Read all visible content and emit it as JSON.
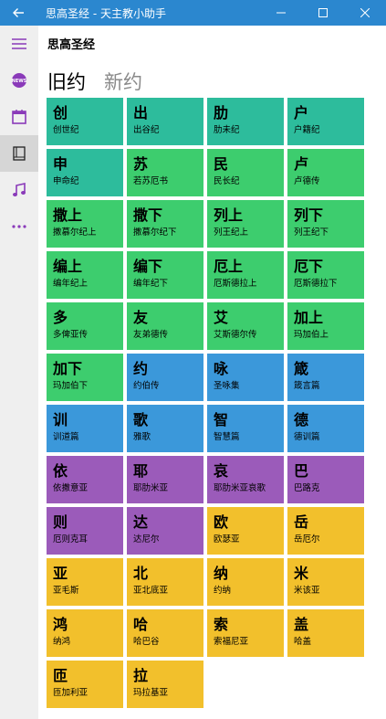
{
  "window": {
    "title": "思高圣经 - 天主教小助手"
  },
  "page": {
    "title": "思高圣经"
  },
  "tabs": [
    {
      "label": "旧约",
      "active": true
    },
    {
      "label": "新约",
      "active": false
    }
  ],
  "colors": {
    "titlebar": "#2b87cf",
    "teal": "#2dbc9c",
    "green": "#3dcd6e",
    "blue": "#3b98da",
    "purple": "#9b5bba",
    "yellow": "#f2c02c",
    "accent_icon": "#8a3ab9"
  },
  "sidebar": {
    "items": [
      {
        "icon": "hamburger-menu-icon"
      },
      {
        "icon": "news-icon"
      },
      {
        "icon": "calendar-icon"
      },
      {
        "icon": "book-icon",
        "active": true
      },
      {
        "icon": "music-note-icon"
      },
      {
        "icon": "more-dots-icon"
      }
    ]
  },
  "books": [
    {
      "abbr": "创",
      "name": "创世纪",
      "color": "teal"
    },
    {
      "abbr": "出",
      "name": "出谷纪",
      "color": "teal"
    },
    {
      "abbr": "肋",
      "name": "肋未纪",
      "color": "teal"
    },
    {
      "abbr": "户",
      "name": "户籍纪",
      "color": "teal"
    },
    {
      "abbr": "申",
      "name": "申命纪",
      "color": "teal"
    },
    {
      "abbr": "苏",
      "name": "若苏厄书",
      "color": "green"
    },
    {
      "abbr": "民",
      "name": "民长纪",
      "color": "green"
    },
    {
      "abbr": "卢",
      "name": "卢德传",
      "color": "green"
    },
    {
      "abbr": "撒上",
      "name": "撒慕尔纪上",
      "color": "green"
    },
    {
      "abbr": "撒下",
      "name": "撒慕尔纪下",
      "color": "green"
    },
    {
      "abbr": "列上",
      "name": "列王纪上",
      "color": "green"
    },
    {
      "abbr": "列下",
      "name": "列王纪下",
      "color": "green"
    },
    {
      "abbr": "编上",
      "name": "编年纪上",
      "color": "green"
    },
    {
      "abbr": "编下",
      "name": "编年纪下",
      "color": "green"
    },
    {
      "abbr": "厄上",
      "name": "厄斯德拉上",
      "color": "green"
    },
    {
      "abbr": "厄下",
      "name": "厄斯德拉下",
      "color": "green"
    },
    {
      "abbr": "多",
      "name": "多俾亚传",
      "color": "green"
    },
    {
      "abbr": "友",
      "name": "友弟德传",
      "color": "green"
    },
    {
      "abbr": "艾",
      "name": "艾斯德尔传",
      "color": "green"
    },
    {
      "abbr": "加上",
      "name": "玛加伯上",
      "color": "green"
    },
    {
      "abbr": "加下",
      "name": "玛加伯下",
      "color": "green"
    },
    {
      "abbr": "约",
      "name": "约伯传",
      "color": "blue"
    },
    {
      "abbr": "咏",
      "name": "圣咏集",
      "color": "blue"
    },
    {
      "abbr": "箴",
      "name": "箴言篇",
      "color": "blue"
    },
    {
      "abbr": "训",
      "name": "训道篇",
      "color": "blue"
    },
    {
      "abbr": "歌",
      "name": "雅歌",
      "color": "blue"
    },
    {
      "abbr": "智",
      "name": "智慧篇",
      "color": "blue"
    },
    {
      "abbr": "德",
      "name": "德训篇",
      "color": "blue"
    },
    {
      "abbr": "依",
      "name": "依撒意亚",
      "color": "purple"
    },
    {
      "abbr": "耶",
      "name": "耶肋米亚",
      "color": "purple"
    },
    {
      "abbr": "哀",
      "name": "耶肋米亚哀歌",
      "color": "purple"
    },
    {
      "abbr": "巴",
      "name": "巴路克",
      "color": "purple"
    },
    {
      "abbr": "则",
      "name": "厄则克耳",
      "color": "purple"
    },
    {
      "abbr": "达",
      "name": "达尼尔",
      "color": "purple"
    },
    {
      "abbr": "欧",
      "name": "欧瑟亚",
      "color": "yellow"
    },
    {
      "abbr": "岳",
      "name": "岳厄尔",
      "color": "yellow"
    },
    {
      "abbr": "亚",
      "name": "亚毛斯",
      "color": "yellow"
    },
    {
      "abbr": "北",
      "name": "亚北底亚",
      "color": "yellow"
    },
    {
      "abbr": "纳",
      "name": "约纳",
      "color": "yellow"
    },
    {
      "abbr": "米",
      "name": "米该亚",
      "color": "yellow"
    },
    {
      "abbr": "鸿",
      "name": "纳鸿",
      "color": "yellow"
    },
    {
      "abbr": "哈",
      "name": "哈巴谷",
      "color": "yellow"
    },
    {
      "abbr": "索",
      "name": "索福尼亚",
      "color": "yellow"
    },
    {
      "abbr": "盖",
      "name": "哈盖",
      "color": "yellow"
    },
    {
      "abbr": "匝",
      "name": "匝加利亚",
      "color": "yellow"
    },
    {
      "abbr": "拉",
      "name": "玛拉基亚",
      "color": "yellow"
    }
  ]
}
